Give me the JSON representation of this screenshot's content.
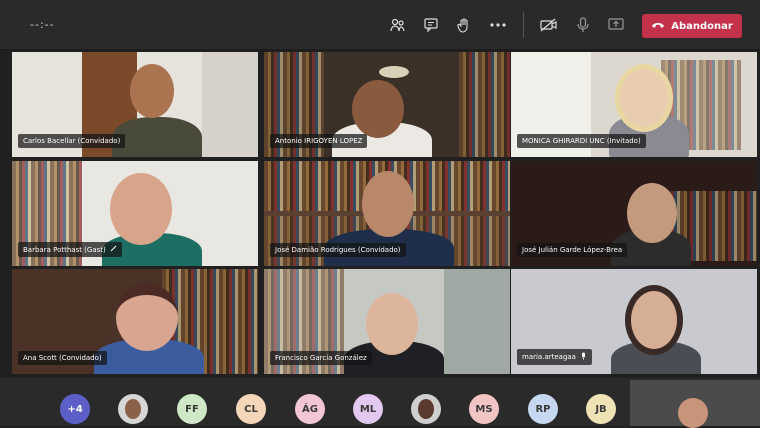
{
  "meeting": {
    "timer": "--:--",
    "leave_label": "Abandonar"
  },
  "toolbar": {
    "icons": [
      "participants-icon",
      "chat-icon",
      "raise-hand-icon",
      "more-options-icon",
      "camera-off-icon",
      "microphone-icon",
      "share-screen-icon"
    ]
  },
  "participants": [
    {
      "name": "Carlos Bacellar (Convidado)"
    },
    {
      "name": "Antonio IRIGOYEN LOPEZ"
    },
    {
      "name": "MONICA GHIRARDI UNC (Invitado)"
    },
    {
      "name": "Barbara Potthast (Gast)"
    },
    {
      "name": "José Damião Rodrigues (Convidado)"
    },
    {
      "name": "José Julián Garde López-Brea"
    },
    {
      "name": "Ana Scott (Convidado)"
    },
    {
      "name": "Francisco García González"
    },
    {
      "name": "maria.arteagaa"
    }
  ],
  "bottom_avatars": [
    {
      "label": "+4",
      "color": "#5b5fc7"
    },
    {
      "label": "",
      "color": "#d6d6d6"
    },
    {
      "label": "FF",
      "color": "#cfe8c8"
    },
    {
      "label": "CL",
      "color": "#f3d7b8"
    },
    {
      "label": "ÁG",
      "color": "#f2c6d3"
    },
    {
      "label": "ML",
      "color": "#e3c8ef"
    },
    {
      "label": "",
      "color": "#cfcfcf"
    },
    {
      "label": "MS",
      "color": "#f3c4c4"
    },
    {
      "label": "RP",
      "color": "#c6d8f0"
    },
    {
      "label": "JB",
      "color": "#efe2b5"
    }
  ],
  "colors": {
    "leave_button": "#c4314b",
    "topbar": "#2a2a2a"
  }
}
